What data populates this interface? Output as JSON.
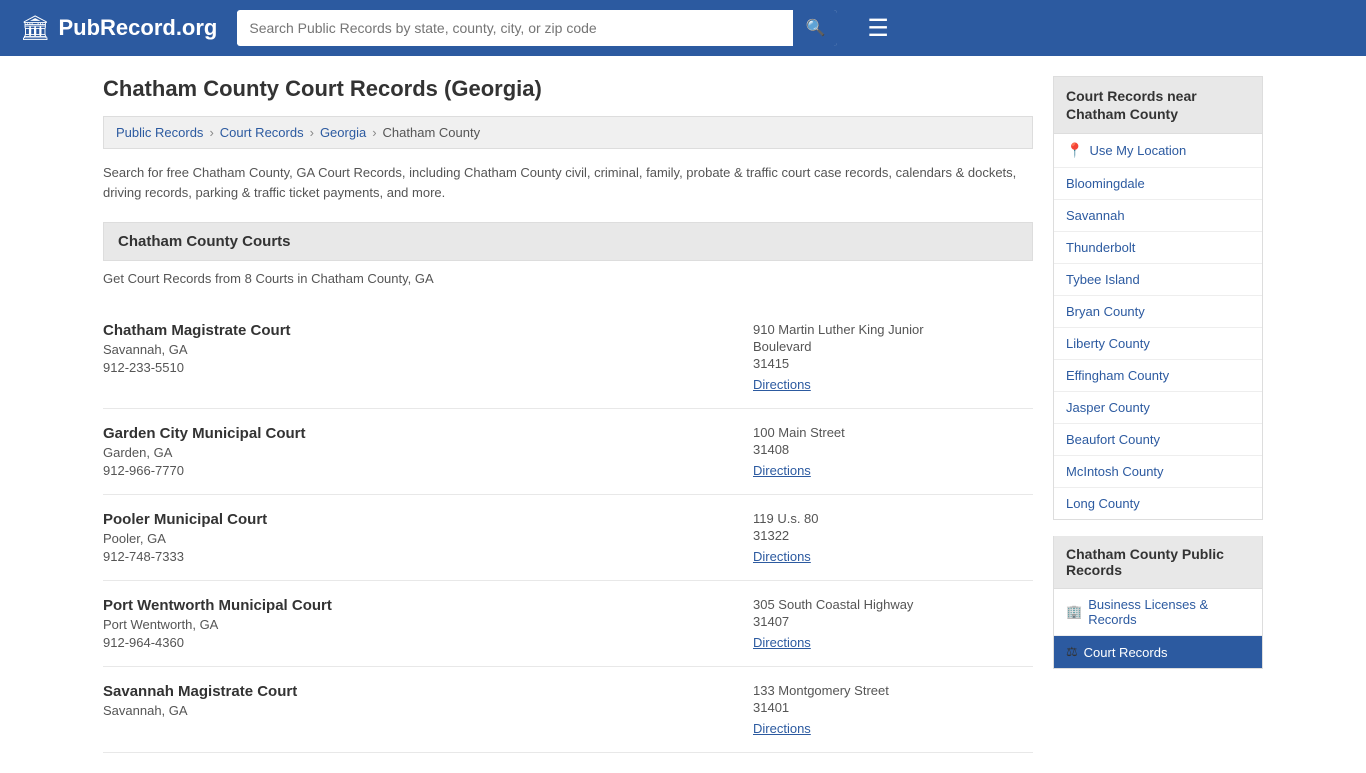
{
  "header": {
    "logo_icon": "🏛",
    "logo_text": "PubRecord.org",
    "search_placeholder": "Search Public Records by state, county, city, or zip code",
    "search_value": ""
  },
  "page": {
    "title": "Chatham County Court Records (Georgia)",
    "breadcrumb": {
      "items": [
        "Public Records",
        "Court Records",
        "Georgia",
        "Chatham County"
      ]
    },
    "description": "Search for free Chatham County, GA Court Records, including Chatham County civil, criminal, family, probate & traffic court case records, calendars & dockets, driving records, parking & traffic ticket payments, and more.",
    "section_title": "Chatham County Courts",
    "courts_count": "Get Court Records from 8 Courts in Chatham County, GA"
  },
  "courts": [
    {
      "name": "Chatham Magistrate Court",
      "city": "Savannah, GA",
      "phone": "912-233-5510",
      "address_line1": "910 Martin Luther King Junior",
      "address_line2": "Boulevard",
      "zip": "31415",
      "directions": "Directions"
    },
    {
      "name": "Garden City Municipal Court",
      "city": "Garden, GA",
      "phone": "912-966-7770",
      "address_line1": "100 Main Street",
      "address_line2": "",
      "zip": "31408",
      "directions": "Directions"
    },
    {
      "name": "Pooler Municipal Court",
      "city": "Pooler, GA",
      "phone": "912-748-7333",
      "address_line1": "119 U.s. 80",
      "address_line2": "",
      "zip": "31322",
      "directions": "Directions"
    },
    {
      "name": "Port Wentworth Municipal Court",
      "city": "Port Wentworth, GA",
      "phone": "912-964-4360",
      "address_line1": "305 South Coastal Highway",
      "address_line2": "",
      "zip": "31407",
      "directions": "Directions"
    },
    {
      "name": "Savannah Magistrate Court",
      "city": "Savannah, GA",
      "phone": "",
      "address_line1": "133 Montgomery Street",
      "address_line2": "",
      "zip": "31401",
      "directions": "Directions"
    }
  ],
  "sidebar": {
    "nearby_title": "Court Records near\nChatham County",
    "use_location": "Use My Location",
    "nearby_items": [
      "Bloomingdale",
      "Savannah",
      "Thunderbolt",
      "Tybee Island",
      "Bryan County",
      "Liberty County",
      "Effingham County",
      "Jasper County",
      "Beaufort County",
      "McIntosh County",
      "Long County"
    ],
    "public_records_title": "Chatham County Public\nRecords",
    "public_records_items": [
      {
        "icon": "🏢",
        "label": "Business Licenses & Records",
        "active": false
      },
      {
        "icon": "⚖",
        "label": "Court Records",
        "active": true
      }
    ]
  }
}
